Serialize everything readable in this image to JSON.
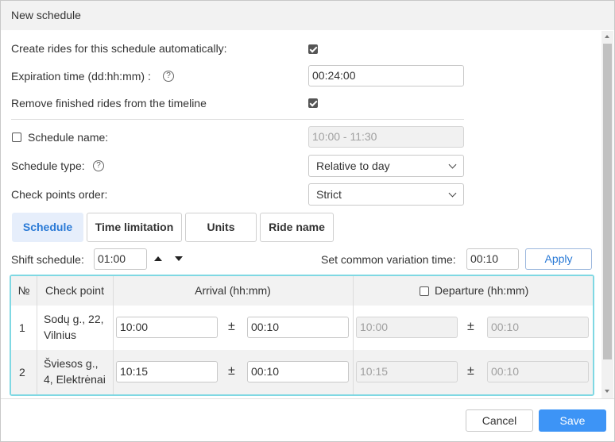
{
  "dialog": {
    "title": "New schedule"
  },
  "form": {
    "create_rides_label": "Create rides for this schedule automatically:",
    "create_rides_checked": true,
    "expiration_label": "Expiration time (dd:hh:mm)  :",
    "expiration_value": "00:24:00",
    "remove_finished_label": "Remove finished rides from the timeline",
    "remove_finished_checked": true,
    "schedule_name_label": "Schedule name:",
    "schedule_name_checked": false,
    "schedule_name_value": "10:00 - 11:30",
    "schedule_type_label": "Schedule type:",
    "schedule_type_value": "Relative to day",
    "checkpoints_order_label": "Check points order:",
    "checkpoints_order_value": "Strict",
    "help_glyph": "?"
  },
  "tabs": [
    {
      "label": "Schedule",
      "active": true
    },
    {
      "label": "Time limitation",
      "active": false
    },
    {
      "label": "Units",
      "active": false
    },
    {
      "label": "Ride name",
      "active": false
    }
  ],
  "shift": {
    "label": "Shift schedule:",
    "value": "01:00",
    "variation_label": "Set common variation time:",
    "variation_value": "00:10",
    "apply_label": "Apply"
  },
  "table": {
    "headers": {
      "num": "№",
      "checkpoint": "Check point",
      "arrival": "Arrival (hh:mm)",
      "departure": "Departure (hh:mm)"
    },
    "departure_checked": false,
    "pm_glyph": "±",
    "rows": [
      {
        "num": "1",
        "checkpoint_line1": "Sodų g., 22,",
        "checkpoint_line2": "Vilnius",
        "arrival": "10:00",
        "arrival_var": "00:10",
        "departure": "10:00",
        "departure_var": "00:10"
      },
      {
        "num": "2",
        "checkpoint_line1": "Šviesos g.,",
        "checkpoint_line2": "4, Elektrėnai",
        "arrival": "10:15",
        "arrival_var": "00:10",
        "departure": "10:15",
        "departure_var": "00:10"
      }
    ]
  },
  "footer": {
    "cancel_label": "Cancel",
    "save_label": "Save"
  },
  "colors": {
    "accent": "#3d94f6",
    "tab_active_bg": "#e6eefb",
    "table_border": "#7fd8e3"
  }
}
